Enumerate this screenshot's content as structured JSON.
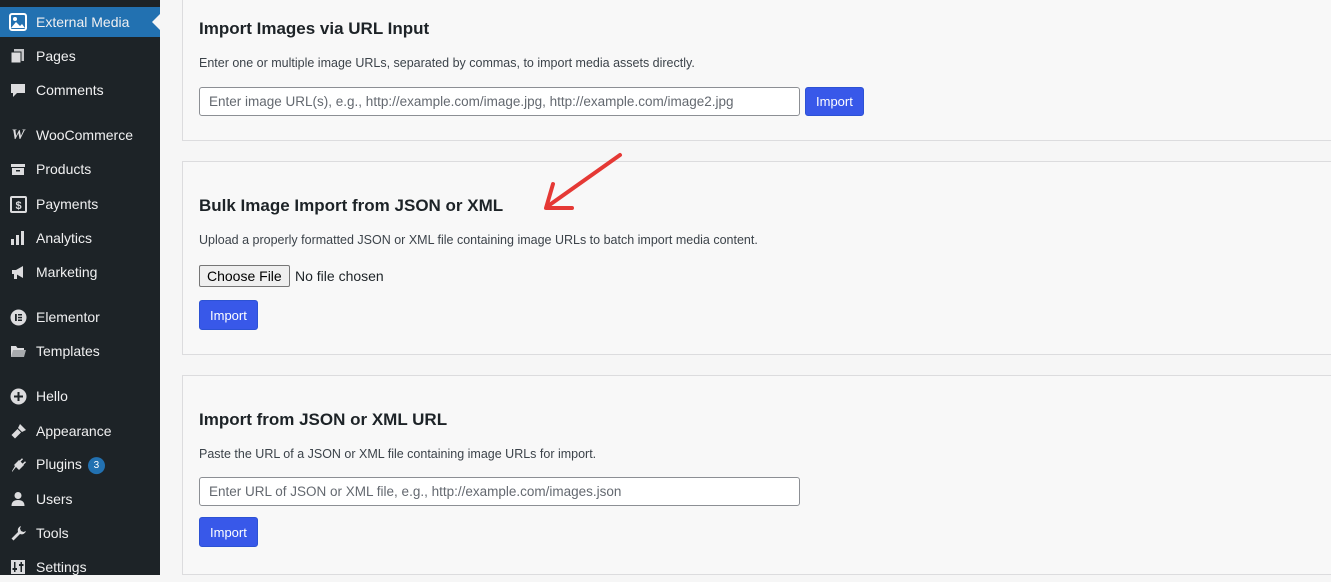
{
  "sidebar": {
    "items": [
      {
        "label": "External Media",
        "icon": "external-media-icon",
        "active": true
      },
      {
        "label": "Pages",
        "icon": "pages-icon"
      },
      {
        "label": "Comments",
        "icon": "comments-icon"
      },
      {
        "label": "WooCommerce",
        "icon": "woocommerce-icon"
      },
      {
        "label": "Products",
        "icon": "products-icon"
      },
      {
        "label": "Payments",
        "icon": "payments-icon"
      },
      {
        "label": "Analytics",
        "icon": "analytics-icon"
      },
      {
        "label": "Marketing",
        "icon": "marketing-icon"
      },
      {
        "label": "Elementor",
        "icon": "elementor-icon"
      },
      {
        "label": "Templates",
        "icon": "templates-icon"
      },
      {
        "label": "Hello",
        "icon": "hello-icon"
      },
      {
        "label": "Appearance",
        "icon": "appearance-icon"
      },
      {
        "label": "Plugins",
        "icon": "plugins-icon",
        "badge": "3"
      },
      {
        "label": "Users",
        "icon": "users-icon"
      },
      {
        "label": "Tools",
        "icon": "tools-icon"
      },
      {
        "label": "Settings",
        "icon": "settings-icon"
      }
    ]
  },
  "sections": {
    "url_import": {
      "title": "Import Images via URL Input",
      "description": "Enter one or multiple image URLs, separated by commas, to import media assets directly.",
      "input_placeholder": "Enter image URL(s), e.g., http://example.com/image.jpg, http://example.com/image2.jpg",
      "input_value": "",
      "button_label": "Import"
    },
    "bulk_import": {
      "title": "Bulk Image Import from JSON or XML",
      "description": "Upload a properly formatted JSON or XML file containing image URLs to batch import media content.",
      "file_button_label": "Choose File",
      "file_status": "No file chosen",
      "button_label": "Import"
    },
    "json_url_import": {
      "title": "Import from JSON or XML URL",
      "description": "Paste the URL of a JSON or XML file containing image URLs for import.",
      "input_placeholder": "Enter URL of JSON or XML file, e.g., http://example.com/images.json",
      "input_value": "",
      "button_label": "Import"
    }
  },
  "annotation": {
    "icon": "red-arrow-icon",
    "color": "#e53935"
  },
  "colors": {
    "sidebar_bg": "#1d2327",
    "active_item": "#2271b1",
    "button": "#3858e9"
  }
}
